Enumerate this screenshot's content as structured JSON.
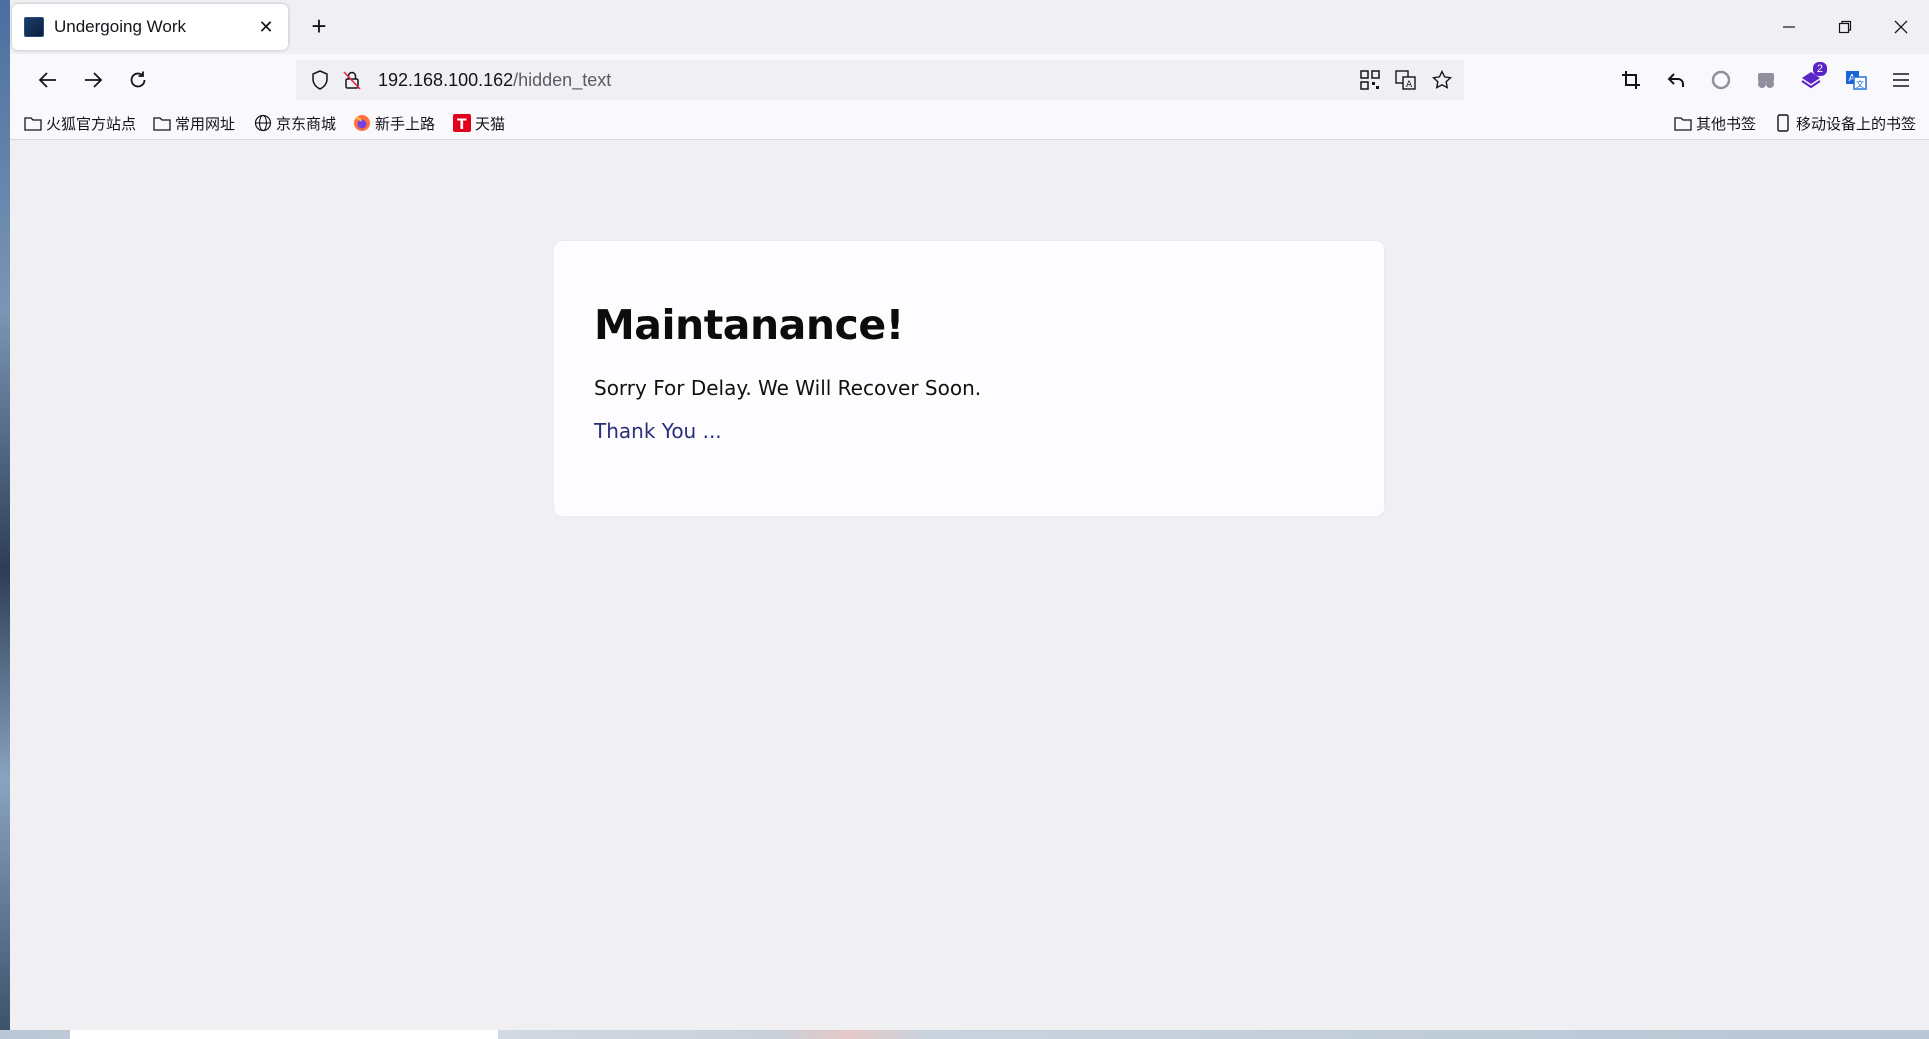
{
  "browser": {
    "tab": {
      "title": "Undergoing Work",
      "close_icon": "close-icon"
    },
    "window_controls": [
      "minimize",
      "restore",
      "close"
    ],
    "url": {
      "host": "192.168.100.162",
      "path": "/hidden_text"
    },
    "bookmarks_left": [
      {
        "label": "火狐官方站点",
        "icon": "folder-icon"
      },
      {
        "label": "常用网址",
        "icon": "folder-icon"
      },
      {
        "label": "京东商城",
        "icon": "globe-icon"
      },
      {
        "label": "新手上路",
        "icon": "firefox-icon"
      },
      {
        "label": "天猫",
        "icon": "tmall-icon"
      }
    ],
    "bookmarks_right": [
      {
        "label": "其他书签",
        "icon": "folder-icon"
      },
      {
        "label": "移动设备上的书签",
        "icon": "mobile-icon"
      }
    ],
    "extension_badge": "2"
  },
  "page": {
    "heading": "Maintanance!",
    "message": "Sorry For Delay. We Will Recover Soon.",
    "thanks": "Thank You ..."
  },
  "colors": {
    "page_background": "#f0f0f3",
    "card_background": "#fdfcfe",
    "thanks_text": "#2a2f7a"
  }
}
